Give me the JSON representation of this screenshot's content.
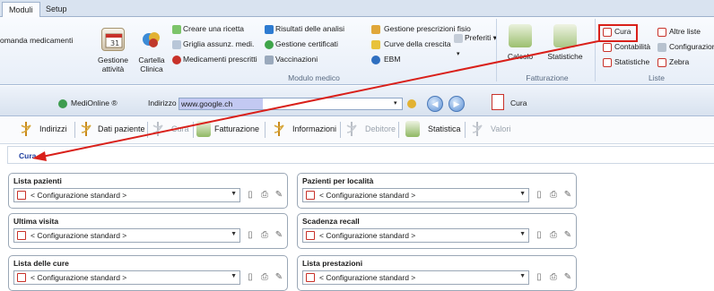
{
  "tabs": [
    {
      "label": "Moduli",
      "active": true
    },
    {
      "label": "Setup",
      "active": false
    }
  ],
  "ribbon": {
    "order_meds": "omanda medicamenti",
    "big_buttons": [
      {
        "label_line1": "Gestione",
        "label_line2": "attività",
        "icon": "calendar-icon"
      },
      {
        "label_line1": "Cartella",
        "label_line2": "Clinica",
        "icon": "clinical-record-icon"
      }
    ],
    "col1": [
      "Creare una ricetta",
      "Griglia assunz. medi.",
      "Medicamenti prescritti"
    ],
    "col2": [
      "Risultati delle analisi",
      "Gestione certificati",
      "Vaccinazioni"
    ],
    "col3": [
      "Gestione prescrizioni fisio",
      "Curve della crescita",
      "EBM"
    ],
    "preferiti": "Preferiti",
    "group_modulo": "Modulo medico",
    "fatt_buttons": [
      "Calcolo",
      "Statistiche"
    ],
    "group_fatt": "Fatturazione",
    "liste_col1": [
      "Cura",
      "Contabilità",
      "Statistiche"
    ],
    "liste_col2": [
      "Altre liste",
      "Configurazior",
      "Zebra"
    ],
    "group_liste": "Liste"
  },
  "address": {
    "app_name": "MediOnline ®",
    "label": "Indirizzo",
    "value": "www.google.ch",
    "current_page": "Cura"
  },
  "toolbar": [
    {
      "label": "Indirizzi",
      "disabled": false
    },
    {
      "label": "Dati paziente",
      "disabled": false
    },
    {
      "label": "Cura",
      "disabled": true
    },
    {
      "label": "Fatturazione",
      "disabled": false
    },
    {
      "label": "Informazioni",
      "disabled": false
    },
    {
      "label": "Debitore",
      "disabled": true
    },
    {
      "label": "Statistica",
      "disabled": false
    },
    {
      "label": "Valori",
      "disabled": true
    }
  ],
  "breadcrumb": "Cura",
  "panels": [
    {
      "title": "Lista pazienti",
      "value": "< Configurazione standard >"
    },
    {
      "title": "Pazienti per località",
      "value": "< Configurazione standard >"
    },
    {
      "title": "Ultima visita",
      "value": "< Configurazione standard >"
    },
    {
      "title": "Scadenza recall",
      "value": "< Configurazione standard >"
    },
    {
      "title": "Lista delle cure",
      "value": "< Configurazione standard >"
    },
    {
      "title": "Lista prestazioni",
      "value": "< Configurazione standard >"
    }
  ],
  "colors": {
    "highlight": "#d9201a",
    "address_selection": "#c3c9f2",
    "breadcrumb_text": "#1f3fa0"
  }
}
